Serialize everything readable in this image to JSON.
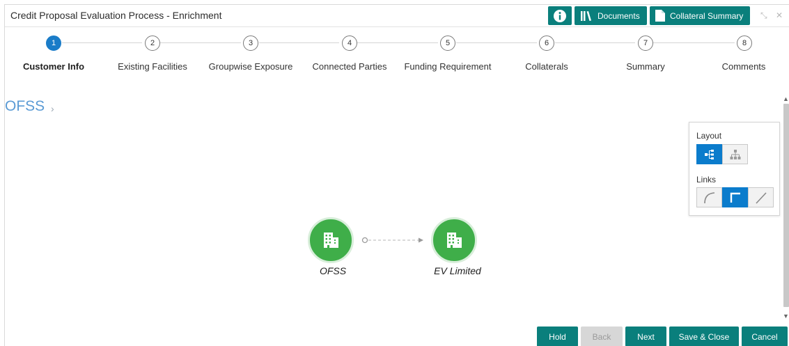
{
  "window": {
    "title": "Credit Proposal Evaluation Process - Enrichment",
    "documents_label": "Documents",
    "collateral_summary_label": "Collateral Summary",
    "info_icon": "info-icon",
    "minimize_icon": "minimize-icon",
    "close_icon": "close-icon"
  },
  "stepper": {
    "steps": [
      {
        "number": "1",
        "label": "Customer Info",
        "active": true
      },
      {
        "number": "2",
        "label": "Existing Facilities",
        "active": false
      },
      {
        "number": "3",
        "label": "Groupwise Exposure",
        "active": false
      },
      {
        "number": "4",
        "label": "Connected Parties",
        "active": false
      },
      {
        "number": "5",
        "label": "Funding Requirement",
        "active": false
      },
      {
        "number": "6",
        "label": "Collaterals",
        "active": false
      },
      {
        "number": "7",
        "label": "Summary",
        "active": false
      },
      {
        "number": "8",
        "label": "Comments",
        "active": false
      }
    ]
  },
  "breadcrumb": {
    "current": "OFSS"
  },
  "controls": {
    "layout_label": "Layout",
    "links_label": "Links",
    "layout_options": [
      "horizontal-tree-icon",
      "vertical-tree-icon"
    ],
    "layout_selected": "horizontal-tree-icon",
    "link_options": [
      "curved-link-icon",
      "orthogonal-link-icon",
      "straight-link-icon"
    ],
    "link_selected": "orthogonal-link-icon"
  },
  "graph": {
    "nodes": [
      {
        "label": "OFSS",
        "icon": "building-icon"
      },
      {
        "label": "EV Limited",
        "icon": "building-icon"
      }
    ],
    "colors": {
      "node": "#3fae49",
      "accent": "#0b7ccc",
      "button": "#0a7f7c"
    }
  },
  "footer": {
    "hold": "Hold",
    "back": "Back",
    "next": "Next",
    "save_close": "Save & Close",
    "cancel": "Cancel"
  }
}
